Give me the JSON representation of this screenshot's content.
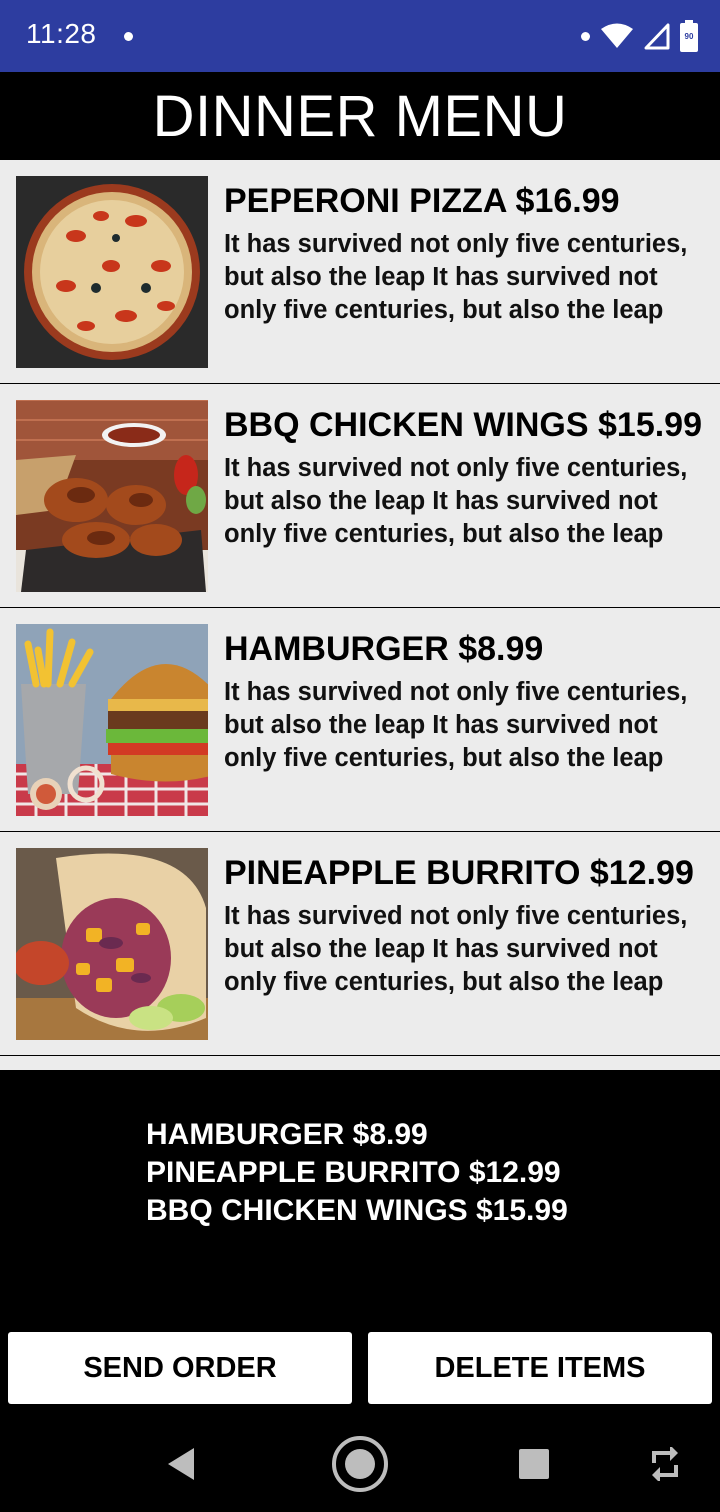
{
  "status_bar": {
    "time": "11:28",
    "battery_level": "90",
    "icons": [
      "notification-dot",
      "wifi-icon",
      "signal-icon",
      "battery-icon"
    ]
  },
  "header": {
    "title": "DINNER MENU"
  },
  "menu": {
    "items": [
      {
        "title": "PEPERONI PIZZA $16.99",
        "description": "It has survived not only five centuries, but also the leap It has survived not only five centuries, but also the leap",
        "image": "pepperoni-pizza-photo"
      },
      {
        "title": "BBQ CHICKEN WINGS $15.99",
        "description": "It has survived not only five centuries, but also the leap It has survived not only five centuries, but also the leap",
        "image": "bbq-chicken-wings-photo"
      },
      {
        "title": "HAMBURGER $8.99",
        "description": "It has survived not only five centuries, but also the leap It has survived not only five centuries, but also the leap",
        "image": "hamburger-photo"
      },
      {
        "title": "PINEAPPLE BURRITO $12.99",
        "description": "It has survived not only five centuries, but also the leap It has survived not only five centuries, but also the leap",
        "image": "pineapple-burrito-photo"
      }
    ]
  },
  "order": {
    "lines": [
      "HAMBURGER $8.99",
      "PINEAPPLE BURRITO $12.99",
      "BBQ CHICKEN WINGS $15.99"
    ]
  },
  "actions": {
    "send_label": "SEND ORDER",
    "delete_label": "DELETE ITEMS"
  },
  "nav": {
    "icons": [
      "back-icon",
      "home-icon",
      "recents-icon",
      "rotate-icon"
    ]
  },
  "colors": {
    "status_bar": "#2d3da0",
    "list_background": "#ececec",
    "panel_background": "#000000",
    "button_background": "#ffffff"
  }
}
